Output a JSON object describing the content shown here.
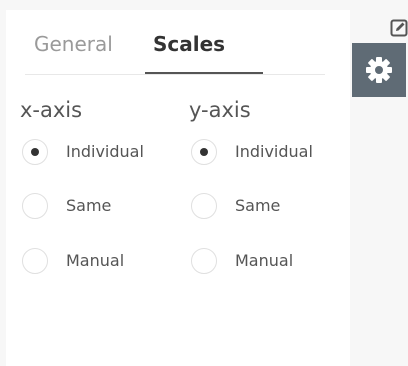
{
  "tabs": [
    {
      "label": "General",
      "active": false
    },
    {
      "label": "Scales",
      "active": true
    }
  ],
  "icons": {
    "settings": "gear-icon",
    "edit": "edit-icon"
  },
  "colors": {
    "settings_button_bg": "#5f6b75",
    "active_tab_text": "#333333",
    "inactive_tab_text": "#9a9a9a"
  },
  "x_axis": {
    "title": "x-axis",
    "selected": "Individual",
    "options": [
      "Individual",
      "Same",
      "Manual"
    ]
  },
  "y_axis": {
    "title": "y-axis",
    "selected": "Individual",
    "options": [
      "Individual",
      "Same",
      "Manual"
    ]
  }
}
